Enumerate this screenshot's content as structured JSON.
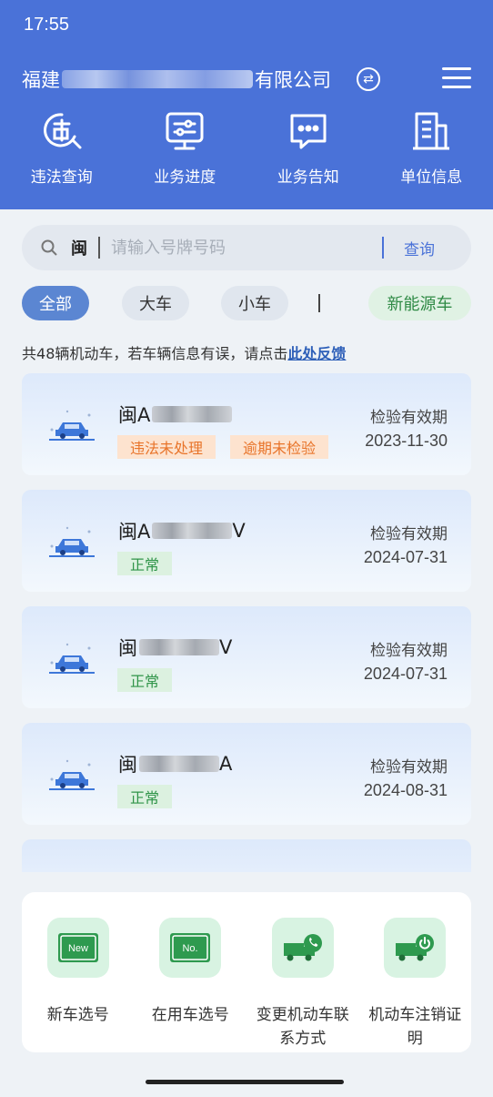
{
  "status_bar": {
    "time": "17:55"
  },
  "header": {
    "company_prefix": "福建",
    "company_suffix": "有限公司",
    "nav": [
      {
        "label": "违法查询",
        "icon": "violation-search-icon"
      },
      {
        "label": "业务进度",
        "icon": "business-progress-icon"
      },
      {
        "label": "业务告知",
        "icon": "business-notice-icon"
      },
      {
        "label": "单位信息",
        "icon": "unit-info-icon"
      }
    ]
  },
  "search": {
    "province": "闽",
    "placeholder": "请输入号牌号码",
    "button": "查询"
  },
  "filters": {
    "all": "全部",
    "big": "大车",
    "small": "小车",
    "ev": "新能源车"
  },
  "notice": {
    "prefix": "共",
    "count": "48",
    "middle": "辆机动车，若车辆信息有误，请点击",
    "link": "此处反馈"
  },
  "vehicles": [
    {
      "plate_start": "闽A",
      "plate_end": "",
      "expiry_label": "检验有效期",
      "expiry_date": "2023-11-30",
      "tags": [
        {
          "text": "违法未处理",
          "color": "orange"
        },
        {
          "text": "逾期未检验",
          "color": "orange"
        }
      ]
    },
    {
      "plate_start": "闽A",
      "plate_end": "V",
      "expiry_label": "检验有效期",
      "expiry_date": "2024-07-31",
      "tags": [
        {
          "text": "正常",
          "color": "green"
        }
      ]
    },
    {
      "plate_start": "闽",
      "plate_end": "V",
      "expiry_label": "检验有效期",
      "expiry_date": "2024-07-31",
      "tags": [
        {
          "text": "正常",
          "color": "green"
        }
      ]
    },
    {
      "plate_start": "闽",
      "plate_end": "A",
      "expiry_label": "检验有效期",
      "expiry_date": "2024-08-31",
      "tags": [
        {
          "text": "正常",
          "color": "green"
        }
      ]
    }
  ],
  "services": [
    {
      "label": "新车选号",
      "icon_text": "New",
      "icon": "new-plate-icon"
    },
    {
      "label": "在用车选号",
      "icon_text": "No.",
      "icon": "plate-number-icon"
    },
    {
      "label": "变更机动车联系方式",
      "icon": "truck-phone-icon"
    },
    {
      "label": "机动车注销证明",
      "icon": "truck-power-icon"
    }
  ],
  "colors": {
    "primary": "#4a72d8",
    "orange": "#e8742a",
    "green": "#2f9448"
  }
}
